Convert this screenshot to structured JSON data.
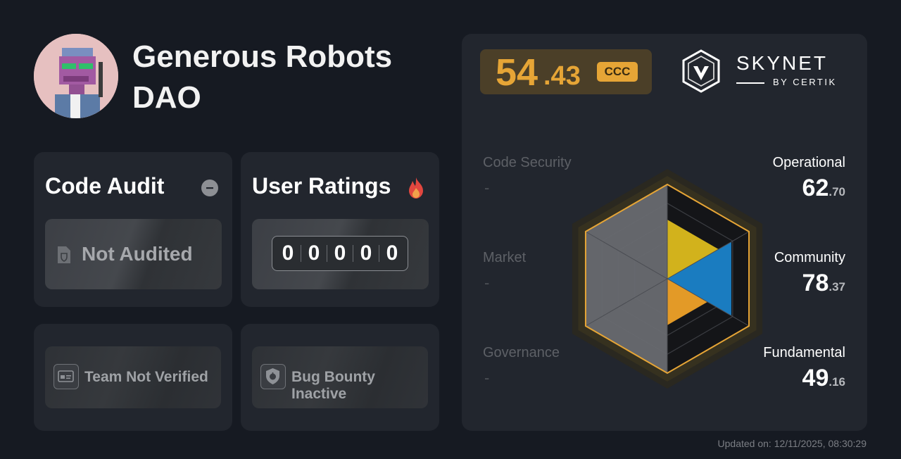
{
  "project": {
    "name": "Generous Robots DAO",
    "avatar_icon": "pixel-robot-avatar"
  },
  "code_audit": {
    "heading": "Code Audit",
    "status_icon": "minus-circle-icon",
    "status_text": "Not Audited"
  },
  "user_ratings": {
    "heading": "User Ratings",
    "icon": "fire-icon",
    "digits": [
      "0",
      "0",
      "0",
      "0",
      "0"
    ]
  },
  "team": {
    "label": "Team Not Verified",
    "icon": "id-card-icon"
  },
  "bug_bounty": {
    "label": "Bug Bounty Inactive",
    "icon": "shield-bug-icon"
  },
  "score": {
    "integer": "54",
    "decimal": ".43",
    "grade": "CCC",
    "accent_color": "#e6a536"
  },
  "brand": {
    "name": "SKYNET",
    "sub": "BY CERTIK"
  },
  "metrics": {
    "code_security": {
      "label": "Code Security",
      "value": "-"
    },
    "market": {
      "label": "Market",
      "value": "-"
    },
    "governance": {
      "label": "Governance",
      "value": "-"
    },
    "operational": {
      "label": "Operational",
      "integer": "62",
      "decimal": ".70"
    },
    "community": {
      "label": "Community",
      "integer": "78",
      "decimal": ".37"
    },
    "fundamental": {
      "label": "Fundamental",
      "integer": "49",
      "decimal": ".16"
    }
  },
  "chart_data": {
    "type": "radar",
    "axes": [
      "Operational",
      "Community",
      "Fundamental",
      "Governance",
      "Market",
      "Code Security"
    ],
    "values": [
      62.7,
      78.37,
      49.16,
      null,
      null,
      null
    ],
    "range": [
      0,
      100
    ],
    "colors": {
      "operational": "#d2b21c",
      "community": "#1a7cc0",
      "fundamental": "#e39a27",
      "unscored": "#686a70"
    }
  },
  "updated": "Updated on: 12/11/2025, 08:30:29"
}
